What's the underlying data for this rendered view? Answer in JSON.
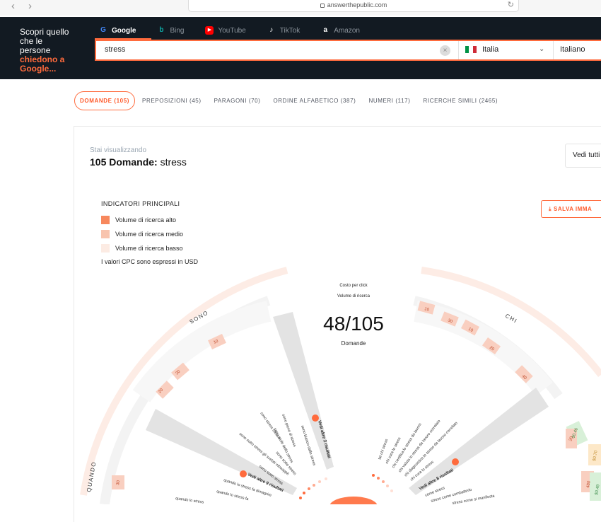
{
  "browser": {
    "back_icon": "chevron-left-icon",
    "forward_icon": "chevron-right-icon",
    "url": "answerthepublic.com"
  },
  "header": {
    "tagline_lines": [
      "Scopri quello",
      "che le",
      "persone"
    ],
    "tagline_accent_lines": [
      "chiedono a",
      "Google..."
    ],
    "engines": [
      {
        "label": "Google",
        "icon": "google-icon",
        "active": true
      },
      {
        "label": "Bing",
        "icon": "bing-icon",
        "active": false
      },
      {
        "label": "YouTube",
        "icon": "youtube-icon",
        "active": false
      },
      {
        "label": "TikTok",
        "icon": "tiktok-icon",
        "active": false
      },
      {
        "label": "Amazon",
        "icon": "amazon-icon",
        "active": false
      }
    ],
    "search_value": "stress",
    "country": "Italia",
    "language": "Italiano"
  },
  "tabs": [
    {
      "label": "DOMANDE (105)",
      "active": true
    },
    {
      "label": "PREPOSIZIONI (45)",
      "active": false
    },
    {
      "label": "PARAGONI (70)",
      "active": false
    },
    {
      "label": "ORDINE ALFABETICO (387)",
      "active": false
    },
    {
      "label": "NUMERI (117)",
      "active": false
    },
    {
      "label": "RICERCHE SIMILI (2465)",
      "active": false
    }
  ],
  "card": {
    "viewing_label": "Stai visualizzando",
    "title_count": "105 Domande:",
    "title_term": "stress",
    "see_all_label": "Vedi tutti",
    "legend_title": "INDICATORI PRINCIPALI",
    "legend_items": [
      {
        "label": "Volume di ricerca alto",
        "color": "#f7885d"
      },
      {
        "label": "Volume di ricerca medio",
        "color": "#f8c4ae"
      },
      {
        "label": "Volume di ricerca basso",
        "color": "#fcebe3"
      }
    ],
    "cpc_note": "I valori CPC sono espressi in USD",
    "save_label": "SALVA IMMA"
  },
  "wheel": {
    "top_label_1": "Costo per click",
    "top_label_2": "Volume di ricerca",
    "count": "48/105",
    "count_label": "Domande",
    "sections": [
      "SONO",
      "CHI",
      "QUANDO"
    ],
    "sono_values": [
      "10",
      "20",
      "20"
    ],
    "chi_values": [
      "10",
      "30",
      "10",
      "20",
      "40"
    ],
    "quando_values": [
      "30"
    ],
    "right_values": [
      "$0.46",
      "$1.0",
      "$0.70",
      "20",
      "480",
      "40",
      "$0.49"
    ],
    "sono_more": "Vedi altre 2 risultati",
    "quando_more": "Vedi altre 9 risultati",
    "chi_more": "Vedi altre 8 risultati",
    "sono_queries": [
      "sono pieno di stress",
      "sono stufo dello stress",
      "sono stress stesso",
      "sono bianco dallo stress",
      "sono sotto stress gli svelati mbaappé",
      "sono sotto stress",
      "sono stato stress",
      "sono sotto stress"
    ],
    "quando_queries": [
      "quando lo stress fa dimagrire",
      "quando lo stress fa",
      "quando lo stress"
    ],
    "chi_queries": [
      "chi cura lo stress",
      "chi certifica lo stress da lavoro",
      "chi valuta lo stress da lavoro correlato",
      "chi diagnostica lo stress da lavoro correlato",
      "chi cura lo stress",
      "tal chi stress"
    ],
    "come_queries": [
      "come stress",
      "stress come combatterlo",
      "stress come si manifesta"
    ]
  }
}
